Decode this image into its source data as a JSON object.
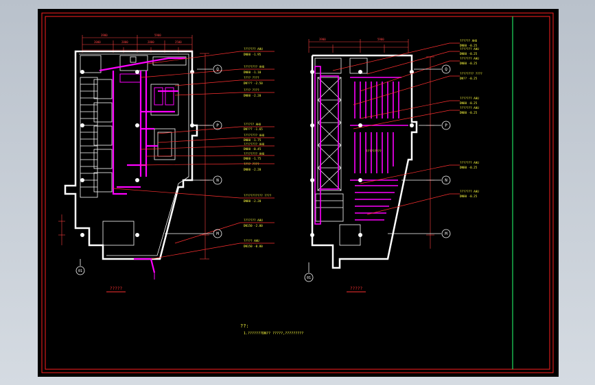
{
  "left_plan": {
    "grid_labels": [
      "Q",
      "P",
      "N",
      "M",
      "01"
    ],
    "plan_title": "?????",
    "leaders": [
      {
        "t1": "??????? AHU",
        "t2": "DN80 -1.95"
      },
      {
        "t1": "???????? AHU",
        "t2": "DN80 -1.10"
      },
      {
        "t1": "???? ????",
        "t2": "DN??? -2.50"
      },
      {
        "t1": "???? ????",
        "t2": "DN80 -2.20"
      },
      {
        "t1": "?????? AHU",
        "t2": "DN??? -1.65"
      },
      {
        "t1": "???????? AHU",
        "t2": "DN80 -1.75"
      },
      {
        "t1": "???????? AHU",
        "t2": "DN80 -0.45"
      },
      {
        "t1": "???????? AHU",
        "t2": "DN80 -1.75"
      },
      {
        "t1": "???? ????",
        "t2": "DN80 -2.20"
      },
      {
        "t1": "??????????? ????",
        "t2": "DN80 -2.20"
      },
      {
        "t1": "??????? AHU",
        "t2": "DN150 -2.00"
      },
      {
        "t1": "????? AHU",
        "t2": "DN150 -0.80"
      }
    ]
  },
  "right_plan": {
    "grid_labels": [
      "Q",
      "P",
      "N",
      "M",
      "01"
    ],
    "plan_title": "?????",
    "leaders": [
      {
        "t1": "?????? AHU",
        "t2": "DN80 -0.25"
      },
      {
        "t1": "??????? AHU",
        "t2": "DN80 -0.25"
      },
      {
        "t1": "??????? AHU",
        "t2": "DN80 -0.25"
      },
      {
        "t1": "???????? ????",
        "t2": "DN?? -0.25"
      },
      {
        "t1": "??????? AHU",
        "t2": "DN80 -0.25"
      },
      {
        "t1": "??????? AHU",
        "t2": "DN80 -0.25"
      },
      {
        "t1": "??????? AHU",
        "t2": "DN80 -0.25"
      },
      {
        "t1": "??????? AHU",
        "t2": "DN80 -0.25"
      }
    ],
    "center_note": "?????????"
  },
  "notes": {
    "heading": "??:",
    "line1": "1.???????DN?? ?????,?????????"
  },
  "colors": {
    "frame": "#ff2020",
    "plan": "#ffffff",
    "pipe": "#ff00ff",
    "dim": "#ff4040",
    "leader": "#ff3030",
    "text": "#ffff40",
    "grid": "#ffffff",
    "green": "#20e060"
  }
}
